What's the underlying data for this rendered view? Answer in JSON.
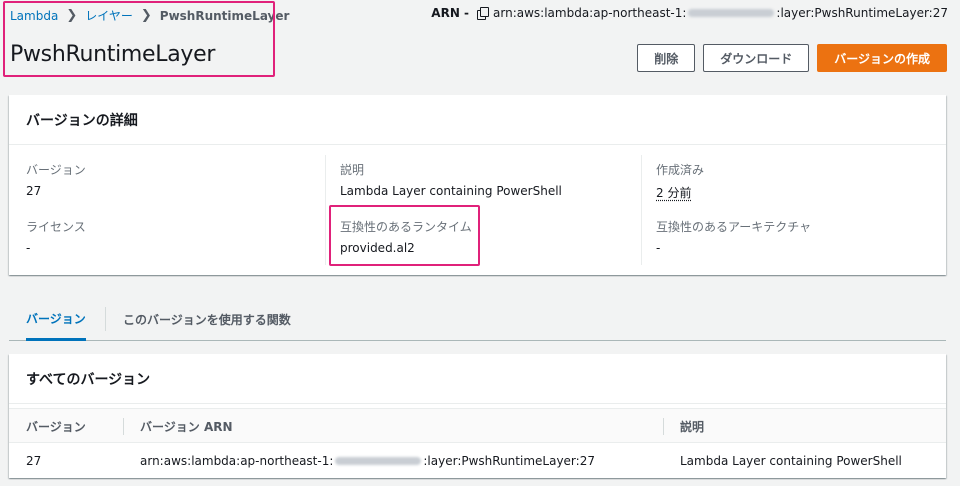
{
  "breadcrumb": {
    "items": [
      {
        "label": "Lambda"
      },
      {
        "label": "レイヤー"
      }
    ],
    "current": "PwshRuntimeLayer"
  },
  "arn": {
    "label": "ARN -",
    "prefix": "arn:aws:lambda:ap-northeast-1:",
    "suffix": ":layer:PwshRuntimeLayer:27"
  },
  "page_title": "PwshRuntimeLayer",
  "actions": {
    "delete": "削除",
    "download": "ダウンロード",
    "create_version": "バージョンの作成"
  },
  "details": {
    "title": "バージョンの詳細",
    "fields": {
      "version": {
        "key": "バージョン",
        "value": "27"
      },
      "description": {
        "key": "説明",
        "value": "Lambda Layer containing PowerShell"
      },
      "created": {
        "key": "作成済み",
        "value": "2 分前"
      },
      "license": {
        "key": "ライセンス",
        "value": "-"
      },
      "runtimes": {
        "key": "互換性のあるランタイム",
        "value": "provided.al2"
      },
      "architectures": {
        "key": "互換性のあるアーキテクチャ",
        "value": "-"
      }
    }
  },
  "tabs": [
    {
      "label": "バージョン",
      "active": true
    },
    {
      "label": "このバージョンを使用する関数",
      "active": false
    }
  ],
  "versions": {
    "title": "すべてのバージョン",
    "columns": [
      "バージョン",
      "バージョン ARN",
      "説明"
    ],
    "rows": [
      {
        "version": "27",
        "arn_prefix": "arn:aws:lambda:ap-northeast-1:",
        "arn_suffix": ":layer:PwshRuntimeLayer:27",
        "description": "Lambda Layer containing PowerShell"
      }
    ]
  },
  "colors": {
    "link": "#0073bb",
    "primary_button": "#ec7211",
    "highlight": "#e0217a"
  }
}
